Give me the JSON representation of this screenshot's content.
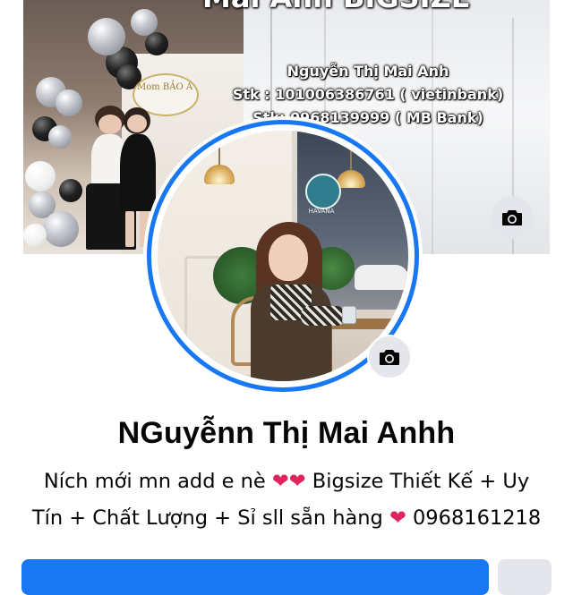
{
  "cover": {
    "title": "Mai Anh BIGSIZE",
    "account_name": "Nguyễn Thị Mai Anh",
    "bank_line_1": "Stk : 101006386761 ( vietinbank)",
    "bank_line_2": "Stk: 0968139999 ( MB Bank)",
    "sign_text": "Mom BẢO A",
    "camera_icon": "camera-icon"
  },
  "avatar": {
    "cafe_sign": "HAVANA",
    "camera_icon": "camera-icon"
  },
  "profile": {
    "name": "NGuyễnn Thị Mai Anhh",
    "bio_line_1_a": "Ních mới mn add e nè ",
    "bio_hearts_1": "❤❤",
    "bio_line_1_b": " Bigsize Thiết Kế + Uy",
    "bio_line_2_a": "Tín + Chất Lượng + Sỉ sll sẵn hàng ",
    "bio_heart_2": "❤",
    "bio_line_2_b": " 0968161218"
  },
  "colors": {
    "accent": "#1877f2",
    "heart": "#e0245e",
    "button_secondary": "#e4e6eb"
  }
}
